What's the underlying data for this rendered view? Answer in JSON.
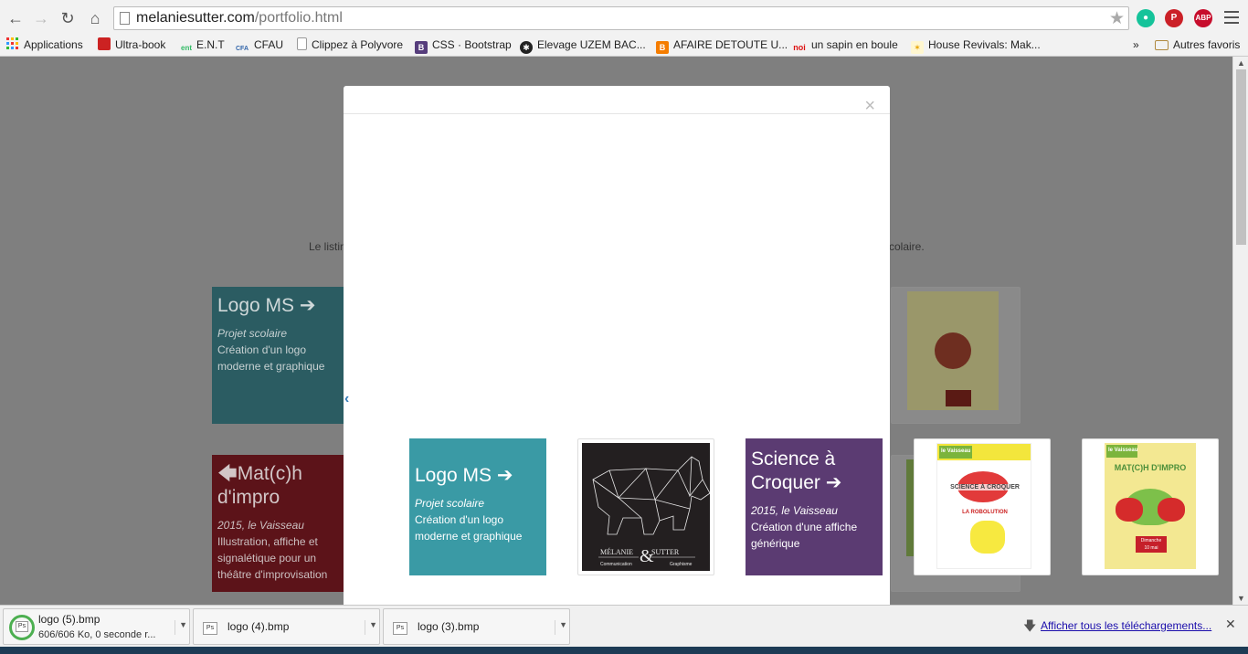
{
  "browser": {
    "url_host": "melaniesutter.com",
    "url_path": "/portfolio.html",
    "extensions": [
      {
        "name": "grammarly-icon",
        "label": "",
        "color": "#15c39a"
      },
      {
        "name": "pinterest-icon",
        "label": "P",
        "color": "#cb2027"
      },
      {
        "name": "adblock-plus-icon",
        "label": "ABP",
        "color": "#c70d2c"
      }
    ]
  },
  "bookmarks": {
    "items": [
      {
        "label": "Applications",
        "icon": "apps-grid-icon"
      },
      {
        "label": "Ultra-book",
        "icon": "ultrabook-icon"
      },
      {
        "label": "E.N.T",
        "icon": "ent-icon"
      },
      {
        "label": "CFAU",
        "icon": "cfau-icon"
      },
      {
        "label": "Clippez à Polyvore",
        "icon": "page-icon"
      },
      {
        "label": "CSS · Bootstrap",
        "icon": "bootstrap-icon"
      },
      {
        "label": "Elevage UZEM BAC...",
        "icon": "uzem-icon"
      },
      {
        "label": "AFAIRE DETOUTE U...",
        "icon": "blogger-icon"
      },
      {
        "label": "un sapin en boule",
        "icon": "noi-icon"
      },
      {
        "label": "House Revivals: Mak...",
        "icon": "house-icon"
      }
    ],
    "overflow": "»",
    "other": "Autres favoris"
  },
  "page": {
    "intro_left": "Le listin",
    "intro_right": "colaire.",
    "tiles": {
      "logo": {
        "title": "Logo MS",
        "meta": "Projet scolaire",
        "desc": "Création d'un logo moderne et graphique"
      },
      "match": {
        "title": "Mat(c)h d'impro",
        "meta": "2015, le Vaisseau",
        "desc": "Illustration, affiche et signalétique pour un théâtre d'improvisation"
      }
    }
  },
  "modal": {
    "close": "×",
    "prev": "‹",
    "items": [
      {
        "title": "Logo MS",
        "meta": "Projet scolaire",
        "desc": "Création d'un logo moderne et graphique"
      },
      {
        "logo_name": "MÉLANIE",
        "logo_amp": "&",
        "logo_name2": "SUTTER",
        "logo_sub1": "Communication",
        "logo_sub2": "Graphisme"
      },
      {
        "title": "Science à Croquer",
        "meta": "2015, le Vaisseau",
        "desc": "Création d'une affiche générique"
      }
    ],
    "poster_science": {
      "brand": "le Vaisseau",
      "title": "SCIENCE À CROQUER",
      "subtitle": "LA ROBOLUTION"
    },
    "poster_match": {
      "brand": "le Vaisseau",
      "title": "MAT(C)H D'IMPRO",
      "date_line1": "Dimanche",
      "date_line2": "10 mai"
    }
  },
  "downloads": {
    "items": [
      {
        "name": "logo (5).bmp",
        "status": "606/606 Ko, 0 seconde r..."
      },
      {
        "name": "logo (4).bmp"
      },
      {
        "name": "logo (3).bmp"
      }
    ],
    "show_all": "Afficher tous les téléchargements..."
  },
  "colors": {
    "teal": "#3a9aa5",
    "crimson": "#a0182d",
    "purple": "#5b3b72",
    "poster_yellow": "#f3e892"
  }
}
